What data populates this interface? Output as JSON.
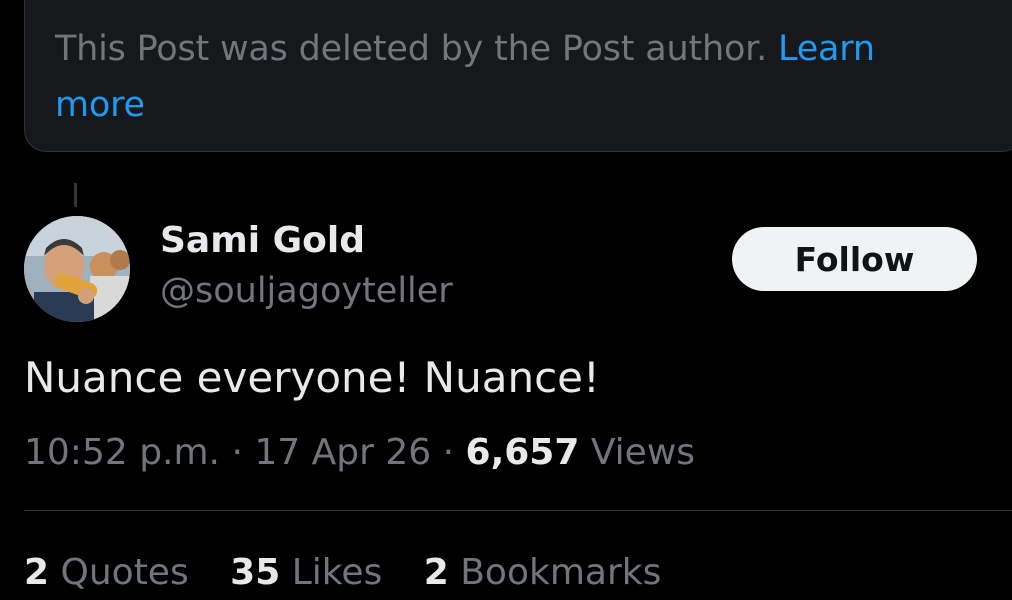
{
  "deleted_notice": {
    "text": "This Post was deleted by the Post author.",
    "link": "Learn more"
  },
  "author": {
    "name": "Sami Gold",
    "handle": "@souljagoyteller",
    "avatar": "profile-photo"
  },
  "follow_label": "Follow",
  "post": {
    "text": "Nuance everyone! Nuance!"
  },
  "meta": {
    "time": "10:52 p.m.",
    "date": "17 Apr 26",
    "separator": "·",
    "views_count": "6,657",
    "views_label": "Views"
  },
  "stats": [
    {
      "count": "2",
      "label": "Quotes"
    },
    {
      "count": "35",
      "label": "Likes"
    },
    {
      "count": "2",
      "label": "Bookmarks"
    }
  ],
  "colors": {
    "background": "#000000",
    "card": "#16181c",
    "muted": "#71767b",
    "text": "#e7e9ea",
    "link": "#1d9bf0"
  }
}
